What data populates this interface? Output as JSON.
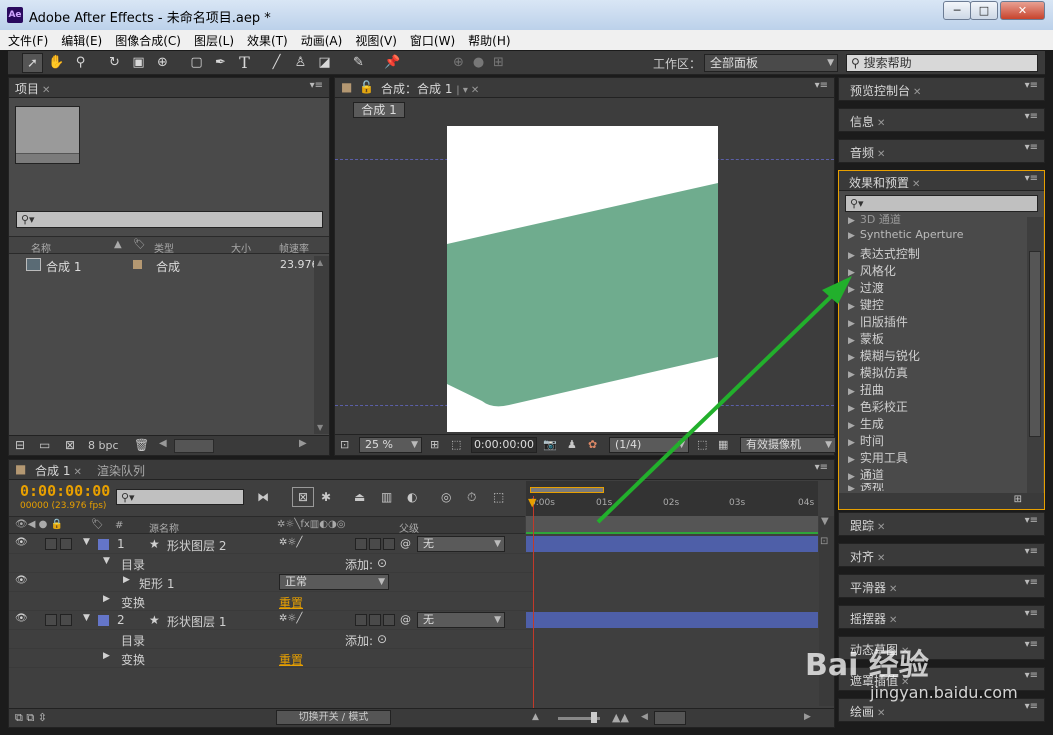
{
  "window": {
    "title": "Adobe After Effects - 未命名项目.aep *",
    "app_icon": "Ae",
    "minimize": "─",
    "maximize": "□",
    "close": "✕"
  },
  "menu": [
    "文件(F)",
    "编辑(E)",
    "图像合成(C)",
    "图层(L)",
    "效果(T)",
    "动画(A)",
    "视图(V)",
    "窗口(W)",
    "帮助(H)"
  ],
  "toolbar": {
    "workspace_label": "工作区：",
    "workspace_value": "全部面板",
    "search_help": "搜索帮助"
  },
  "project": {
    "tab": "项目",
    "columns": [
      "名称",
      "类型",
      "大小",
      "帧速率"
    ],
    "items": [
      {
        "name": "合成 1",
        "type": "合成",
        "size": "",
        "fps": "23.976"
      }
    ],
    "bpc": "8 bpc"
  },
  "composition": {
    "tab": "合成：合成 1",
    "sub_tab": "合成 1",
    "zoom": "25 %",
    "timecode": "0:00:00:00",
    "resolution": "(1/4)",
    "camera": "有效摄像机",
    "colors": {
      "shape": "#6fac8e",
      "canvas": "#ffffff"
    }
  },
  "right_panels": {
    "preview": "预览控制台",
    "info": "信息",
    "audio": "音频",
    "effects": "效果和预置",
    "tracker": "跟踪",
    "align": "对齐",
    "smoother": "平滑器",
    "wiggler": "摇摆器",
    "motion_sketch": "动态草图",
    "mask_interp": "遮罩插值",
    "paint": "绘画"
  },
  "effects_list": [
    "3D 通道",
    "Synthetic Aperture",
    "表达式控制",
    "风格化",
    "过渡",
    "键控",
    "旧版插件",
    "蒙板",
    "模糊与锐化",
    "模拟仿真",
    "扭曲",
    "色彩校正",
    "生成",
    "时间",
    "实用工具",
    "通道",
    "透视"
  ],
  "timeline": {
    "tab": "合成 1",
    "render_tab": "渲染队列",
    "timecode": "0:00:00:00",
    "frames": "00000 (23.976 fps)",
    "col_source": "源名称",
    "col_parent": "父级",
    "col_num": "#",
    "layers": [
      {
        "num": "1",
        "name": "形状图层 2",
        "parent": "无"
      },
      {
        "num": "2",
        "name": "形状图层 1",
        "parent": "无"
      }
    ],
    "contents": "目录",
    "add": "添加:",
    "rect": "矩形 1",
    "blend": "正常",
    "transform": "变换",
    "reset": "重置",
    "toggle": "切换开关 / 模式",
    "ruler": [
      "0:00s",
      "01s",
      "02s",
      "03s",
      "04s"
    ]
  },
  "watermark": {
    "brand": "Bai 经验",
    "url": "jingyan.baidu.com"
  }
}
